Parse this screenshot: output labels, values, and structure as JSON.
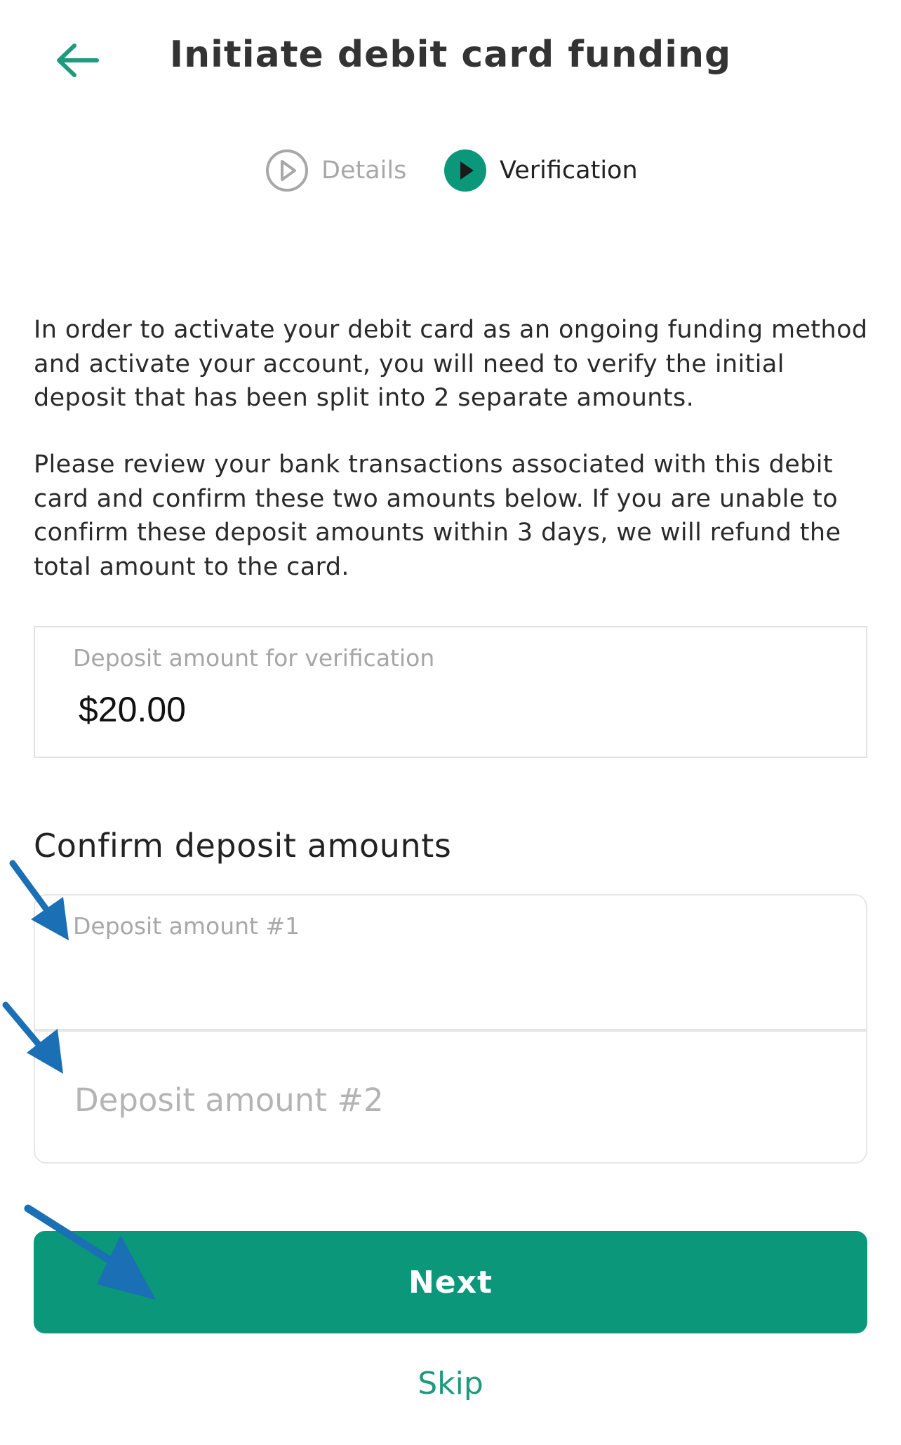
{
  "header": {
    "title": "Initiate debit card funding",
    "back_icon": "arrow-left-icon",
    "accent_color": "#1e9a7e"
  },
  "stepper": {
    "steps": [
      {
        "label": "Details",
        "state": "completed",
        "icon": "play-outline-icon"
      },
      {
        "label": "Verification",
        "state": "active",
        "icon": "play-filled-icon"
      }
    ]
  },
  "body": {
    "paragraph1": "In order to activate your debit card as an ongoing funding method and activate your account, you will need to verify the initial deposit that has been split into 2 separate amounts.",
    "paragraph2": "Please review your bank transactions associated with this debit card and confirm these two amounts below.  If you are unable to confirm these deposit amounts within 3 days, we will refund the total amount to the card."
  },
  "deposit_verification": {
    "label": "Deposit amount for verification",
    "value": "$20.00"
  },
  "confirm": {
    "section_title": "Confirm deposit amounts",
    "amount1": {
      "label": "Deposit amount #1",
      "value": ""
    },
    "amount2": {
      "placeholder": "Deposit amount #2",
      "value": ""
    }
  },
  "actions": {
    "next_label": "Next",
    "skip_label": "Skip",
    "next_color": "#0b977a"
  },
  "annotations": {
    "arrow_color": "#1a6fb5",
    "arrow_icon": "annotation-arrow-icon"
  }
}
